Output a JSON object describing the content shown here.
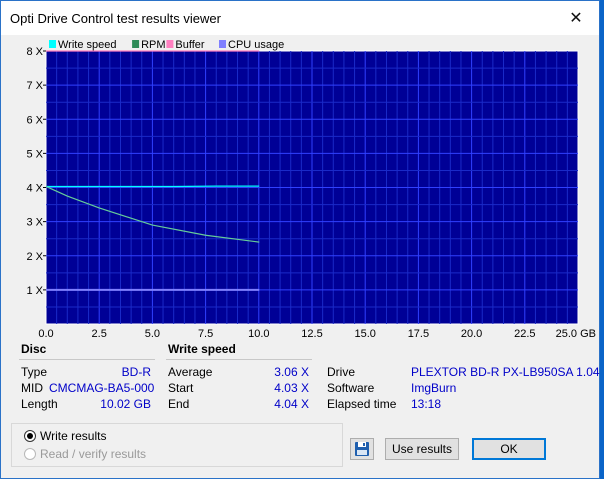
{
  "window": {
    "title": "Opti Drive Control test results viewer",
    "close_glyph": "✕"
  },
  "chart_data": {
    "type": "line",
    "legend": [
      "Write speed",
      "RPM",
      "Buffer",
      "CPU usage"
    ],
    "legend_colors": [
      "#00ffff",
      "#2e8b57",
      "#ff80c0",
      "#8080ff"
    ],
    "legend_placement": "top-left",
    "x_ticks": [
      "0.0",
      "2.5",
      "5.0",
      "7.5",
      "10.0",
      "12.5",
      "15.0",
      "17.5",
      "20.0",
      "22.5",
      "25.0 GB"
    ],
    "y_ticks": [
      "8 X",
      "7 X",
      "6 X",
      "5 X",
      "4 X",
      "3 X",
      "2 X",
      "1 X"
    ],
    "xlim": [
      0,
      25
    ],
    "ylim": [
      0,
      8
    ],
    "grid": true,
    "series": [
      {
        "name": "Write speed",
        "color": "#00ffff",
        "x": [
          0,
          1.0,
          2.0,
          4.0,
          6.0,
          8.0,
          10.02
        ],
        "y": [
          4.03,
          4.03,
          4.03,
          4.03,
          4.03,
          4.04,
          4.04
        ]
      },
      {
        "name": "RPM",
        "color": "#66cc99",
        "x": [
          0,
          1.0,
          2.5,
          5.0,
          7.5,
          10.02
        ],
        "y": [
          4.03,
          3.75,
          3.4,
          2.9,
          2.6,
          2.4
        ]
      },
      {
        "name": "Buffer",
        "color": "#ff80c0",
        "x": [
          0,
          10.02
        ],
        "y": [
          8.0,
          8.0
        ]
      },
      {
        "name": "CPU usage",
        "color": "#8080ff",
        "x": [
          0,
          2.5,
          5.0,
          7.5,
          10.02
        ],
        "y": [
          1.0,
          1.0,
          1.0,
          1.0,
          1.0
        ]
      }
    ]
  },
  "disc": {
    "header": "Disc",
    "type_label": "Type",
    "type_value": "BD-R",
    "mid_label": "MID",
    "mid_value": "CMCMAG-BA5-000",
    "length_label": "Length",
    "length_value": "10.02 GB"
  },
  "write_speed": {
    "header": "Write speed",
    "average_label": "Average",
    "average_value": "3.06 X",
    "start_label": "Start",
    "start_value": "4.03 X",
    "end_label": "End",
    "end_value": "4.04 X"
  },
  "drive_info": {
    "drive_label": "Drive",
    "drive_value": "PLEXTOR  BD-R  PX-LB950SA 1.04",
    "software_label": "Software",
    "software_value": "ImgBurn",
    "elapsed_label": "Elapsed time",
    "elapsed_value": "13:18"
  },
  "options": {
    "write_results": "Write results",
    "read_verify_results": "Read / verify results",
    "selected": "Write results"
  },
  "buttons": {
    "save_icon": "floppy-disk",
    "use_results": "Use results",
    "ok": "OK"
  }
}
